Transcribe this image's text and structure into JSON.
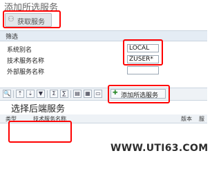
{
  "page": {
    "title": "添加所选服务",
    "fetch_button": {
      "label": "获取服务",
      "icon": "glasses-icon"
    },
    "filter": {
      "header": "筛选",
      "fields": [
        {
          "label": "系统别名",
          "value": "LOCAL"
        },
        {
          "label": "技术服务名称",
          "value": "ZUSER*"
        },
        {
          "label": "外部服务名称",
          "value": ""
        }
      ]
    },
    "toolbar": {
      "buttons": [
        {
          "name": "details-icon",
          "glyph": "🔍"
        },
        {
          "name": "sort-asc-icon",
          "glyph": "≡"
        },
        {
          "name": "sort-desc-icon",
          "glyph": "≡"
        },
        {
          "name": "filter-icon",
          "glyph": "▼"
        },
        {
          "name": "sum-icon",
          "glyph": "Σ"
        },
        {
          "name": "export-icon",
          "glyph": "▤"
        },
        {
          "name": "layout-icon",
          "glyph": "▦"
        }
      ],
      "add_button": {
        "label": "添加所选服务",
        "icon": "add-icon"
      }
    },
    "section_title": "选择后端服务",
    "table": {
      "columns": [
        "类型",
        "技术服务名称",
        "版本",
        "服"
      ]
    },
    "watermark": {
      "text": "WWW.UTI63.COM"
    },
    "colors": {
      "highlight": "#ff0000",
      "header_bg": "#e4ecf4"
    }
  }
}
